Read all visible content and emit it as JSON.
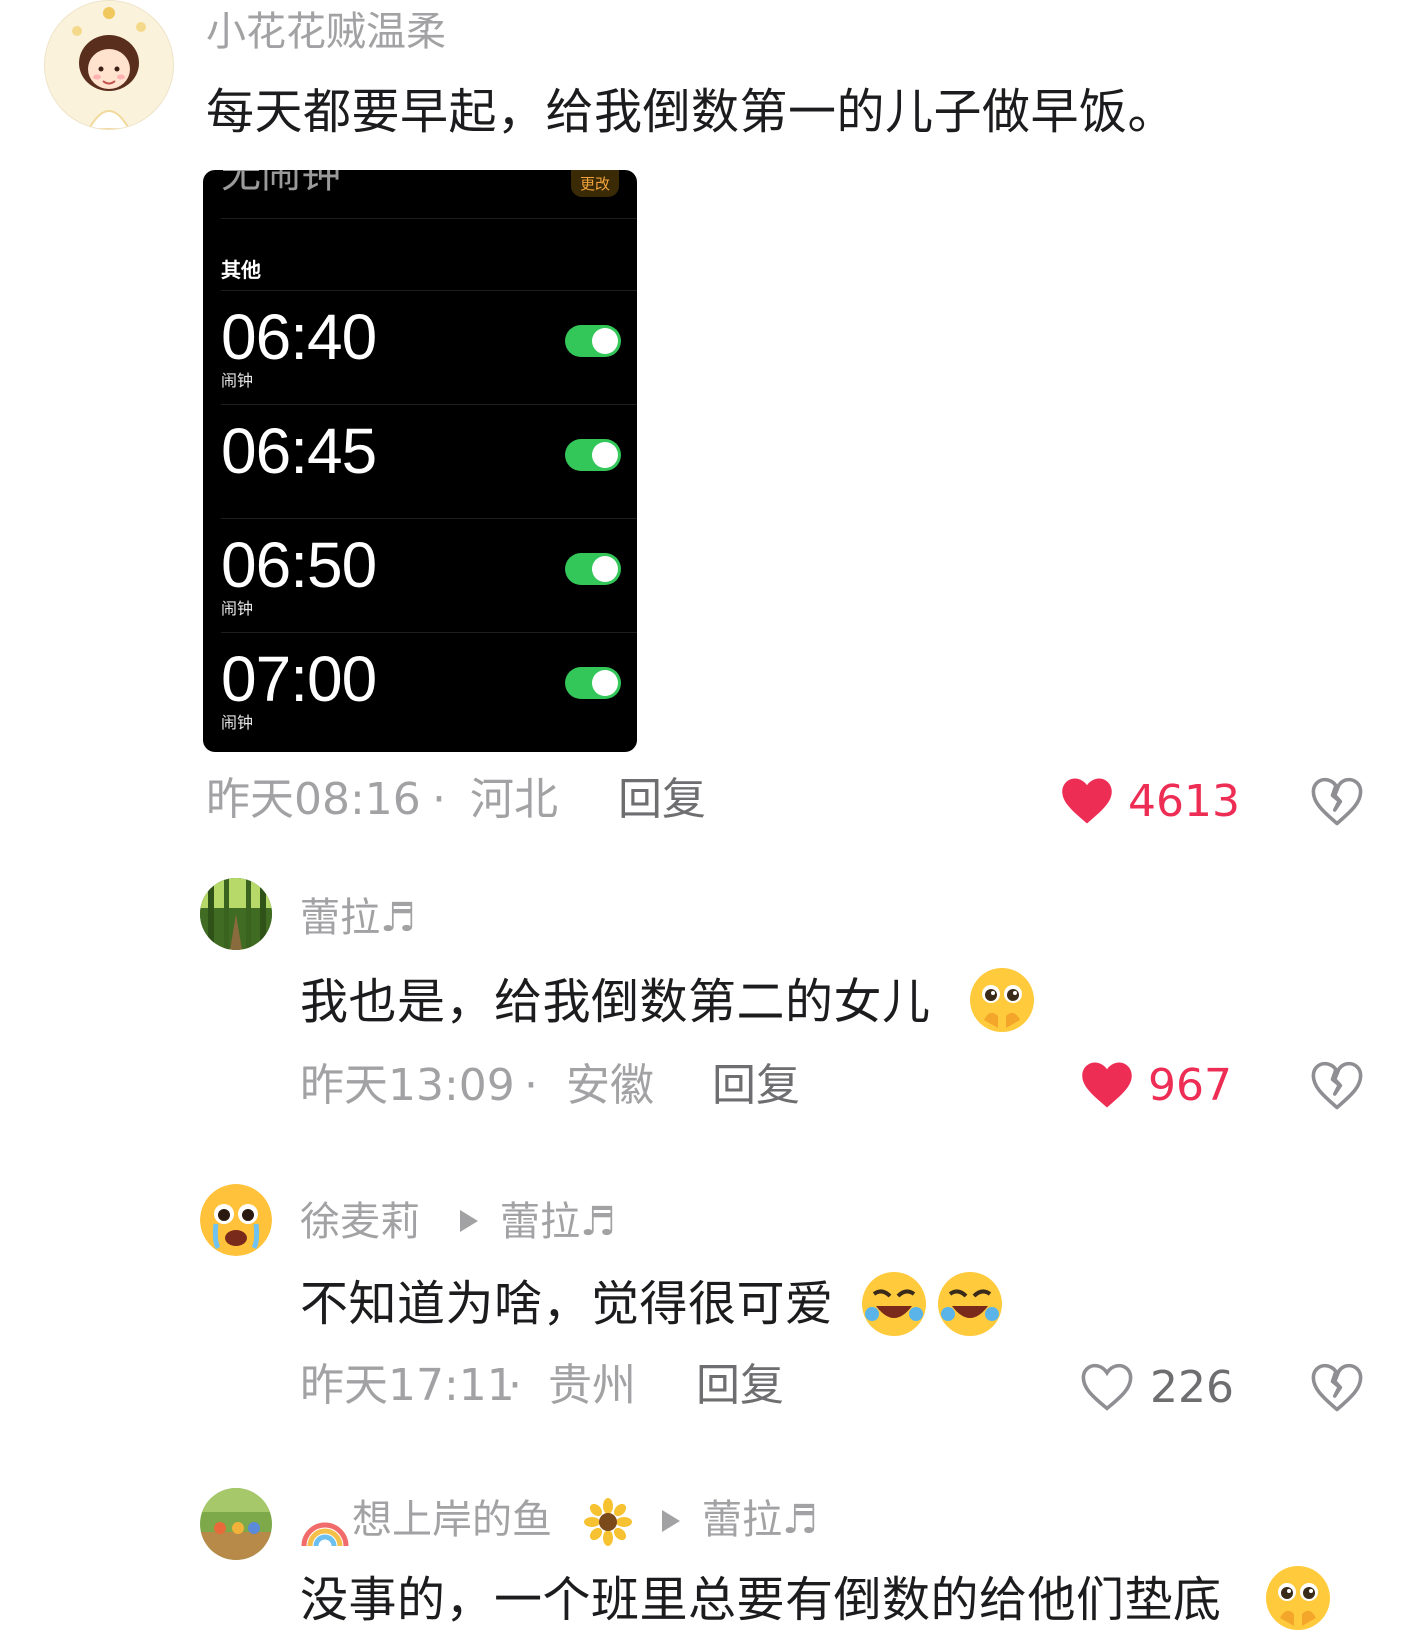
{
  "comment": {
    "username": "小花花贼温柔",
    "text": "每天都要早起，给我倒数第一的儿子做早饭。",
    "image": {
      "header_title": "无闹钟",
      "header_button": "更改",
      "section_label": "其他",
      "alarms": [
        {
          "time": "06:40",
          "label": "闹钟",
          "enabled": true
        },
        {
          "time": "06:45",
          "label": "",
          "enabled": true
        },
        {
          "time": "06:50",
          "label": "闹钟",
          "enabled": true
        },
        {
          "time": "07:00",
          "label": "闹钟",
          "enabled": true
        }
      ]
    },
    "time": "昨天08:16",
    "location": "河北",
    "reply_label": "回复",
    "likes": "4613",
    "liked": true
  },
  "replies": [
    {
      "username": "蕾拉♬",
      "text": "我也是，给我倒数第二的女儿",
      "emoji": "pleading-face-hands",
      "time": "昨天13:09",
      "location": "安徽",
      "reply_label": "回复",
      "likes": "967",
      "liked": true
    },
    {
      "username": "徐麦莉",
      "reply_to": "蕾拉♬",
      "text": "不知道为啥，觉得很可爱",
      "emoji": "rolling-laughing-face",
      "time": "昨天17:11",
      "location": "贵州",
      "reply_label": "回复",
      "likes": "226",
      "liked": false
    },
    {
      "username_prefix_icon": "rainbow",
      "username": "想上岸的鱼",
      "username_suffix_icon": "sunflower",
      "reply_to": "蕾拉♬",
      "text": "没事的，一个班里总要有倒数的给他们垫底",
      "emoji": "pleading-face-hands"
    }
  ],
  "separator": "·",
  "colors": {
    "like_active": "#ee2d55",
    "meta_gray": "#a2a2a4",
    "toggle_on": "#33c75a"
  }
}
